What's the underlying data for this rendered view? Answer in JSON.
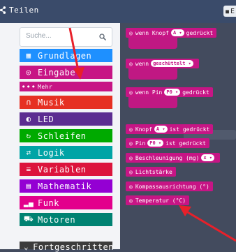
{
  "topbar": {
    "share_label": "Teilen",
    "right_label": "E"
  },
  "search": {
    "placeholder": "Suche..."
  },
  "categories": [
    {
      "label": "Grundlagen",
      "color": "#1e90ff",
      "icon": "grid-icon"
    },
    {
      "label": "Eingabe",
      "color": "#c71585",
      "icon": "target-icon"
    },
    {
      "label": "Mehr",
      "color": "#c71585",
      "icon": "more-dots-icon"
    },
    {
      "label": "Musik",
      "color": "#e63022",
      "icon": "headphones-icon"
    },
    {
      "label": "LED",
      "color": "#5c2d91",
      "icon": "toggle-icon"
    },
    {
      "label": "Schleifen",
      "color": "#00aa00",
      "icon": "loop-icon"
    },
    {
      "label": "Logik",
      "color": "#00a4a6",
      "icon": "shuffle-icon"
    },
    {
      "label": "Variablen",
      "color": "#dc143c",
      "icon": "list-icon"
    },
    {
      "label": "Mathematik",
      "color": "#9400d3",
      "icon": "calculator-icon"
    },
    {
      "label": "Funk",
      "color": "#e3008c",
      "icon": "signal-icon"
    },
    {
      "label": "Motoren",
      "color": "#008272",
      "icon": "car-icon"
    },
    {
      "label": "Fortgeschritten",
      "color": "#3c3c3c",
      "icon": "chevron-down-icon"
    }
  ],
  "blocks": {
    "knopf_pressed": {
      "pre": "wenn Knopf",
      "value": "A",
      "post": "gedrückt"
    },
    "shaken": {
      "pre": "wenn",
      "value": "geschüttelt"
    },
    "pin_pressed": {
      "pre": "wenn Pin",
      "value": "P0",
      "post": "gedrückt"
    },
    "knopf_is": {
      "pre": "Knopf",
      "value": "A",
      "post": "ist gedrückt"
    },
    "pin_is": {
      "pre": "Pin",
      "value": "P0",
      "post": "ist gedrückt"
    },
    "accel": {
      "pre": "Beschleunigung (mg)",
      "value": "x"
    },
    "light": {
      "label": "Lichtstärke"
    },
    "compass": {
      "label": "Kompassausrichtung (°)"
    },
    "temp": {
      "label": "Temperatur (°C)"
    }
  },
  "colors": {
    "input_block": "#c71585",
    "arrow": "#e8202a"
  }
}
